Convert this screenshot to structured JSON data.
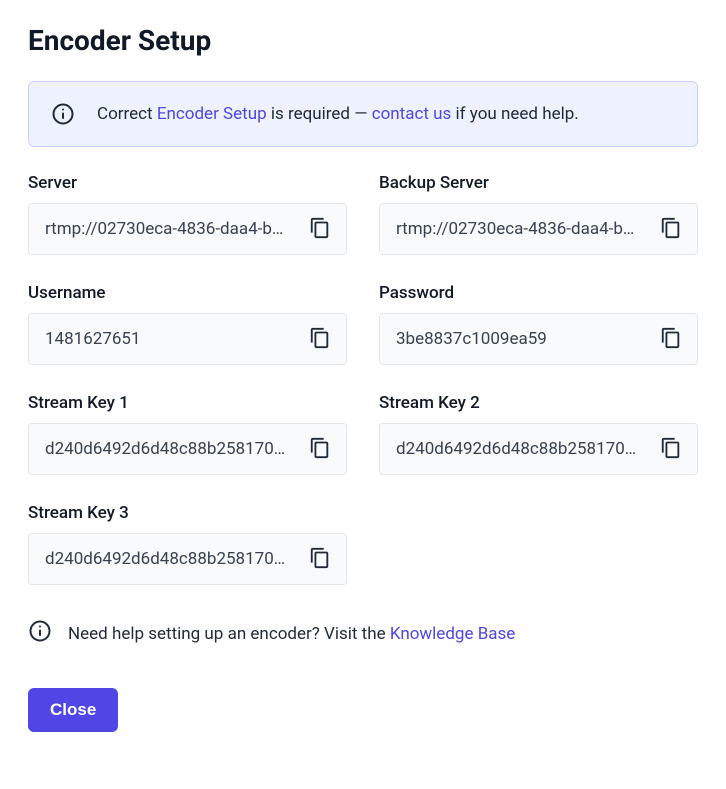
{
  "title": "Encoder Setup",
  "alert": {
    "prefix": "Correct ",
    "link1_text": "Encoder Setup",
    "middle": " is required — ",
    "link2_text": "contact us",
    "suffix": " if you need help."
  },
  "fields": {
    "server": {
      "label": "Server",
      "value": "rtmp://02730eca-4836-daa4-b…"
    },
    "backup_server": {
      "label": "Backup Server",
      "value": "rtmp://02730eca-4836-daa4-b…"
    },
    "username": {
      "label": "Username",
      "value": "1481627651"
    },
    "password": {
      "label": "Password",
      "value": "3be8837c1009ea59"
    },
    "stream_key_1": {
      "label": "Stream Key 1",
      "value": "d240d6492d6d48c88b258170…"
    },
    "stream_key_2": {
      "label": "Stream Key 2",
      "value": "d240d6492d6d48c88b258170…"
    },
    "stream_key_3": {
      "label": "Stream Key 3",
      "value": "d240d6492d6d48c88b258170…"
    }
  },
  "help": {
    "prefix": "Need help setting up an encoder? Visit the ",
    "link_text": "Knowledge Base"
  },
  "close_label": "Close"
}
